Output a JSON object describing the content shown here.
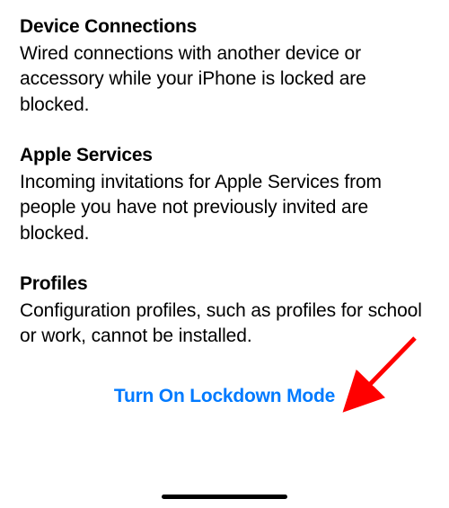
{
  "sections": [
    {
      "heading": "Device Connections",
      "body": "Wired connections with another device or accessory while your iPhone is locked are blocked."
    },
    {
      "heading": "Apple Services",
      "body": "Incoming invitations for Apple Services from people you have not previously invited are blocked."
    },
    {
      "heading": "Profiles",
      "body": "Configuration profiles, such as profiles for school or work, cannot be installed."
    }
  ],
  "action": {
    "label": "Turn On Lockdown Mode"
  },
  "colors": {
    "link": "#007aff",
    "arrow": "#ff0000"
  }
}
